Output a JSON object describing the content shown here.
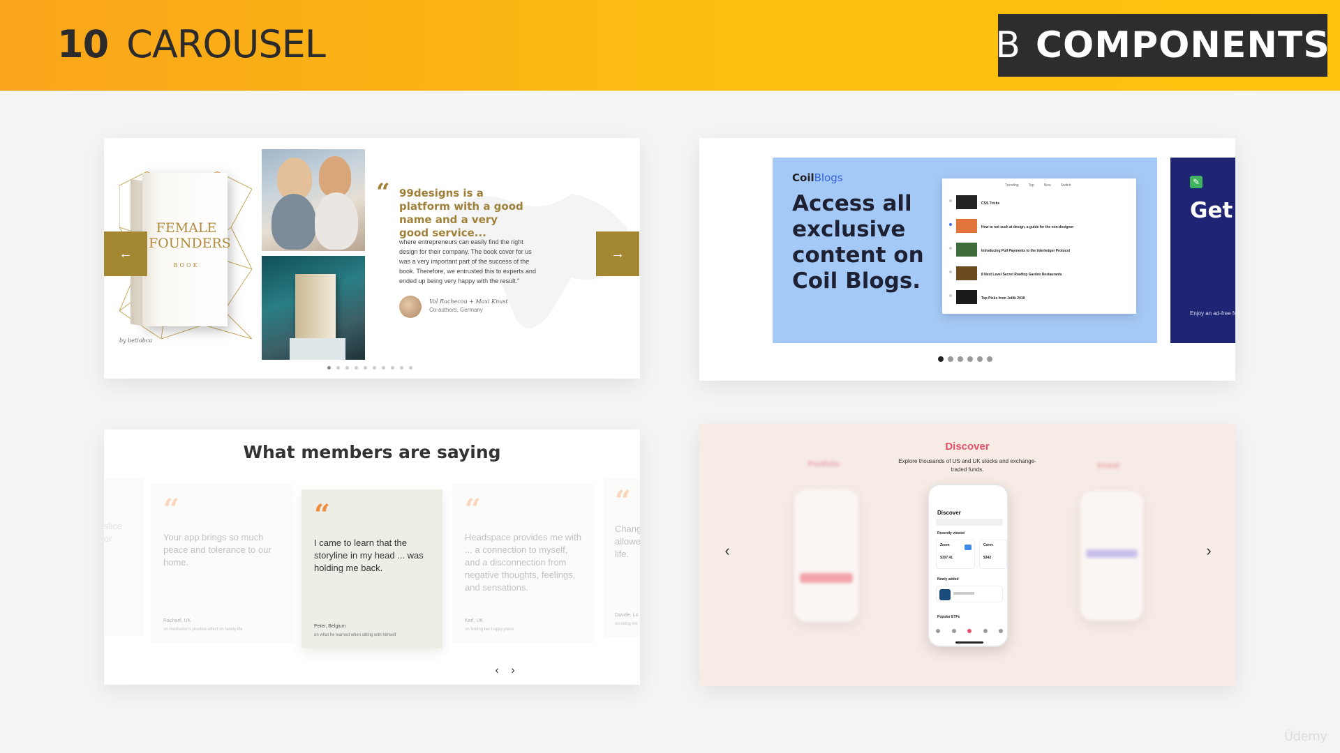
{
  "header": {
    "lecture_number": "10",
    "lecture_title": "CAROUSEL",
    "section_letter": "B",
    "section_name": "COMPONENTS",
    "gradient_colors": [
      "#f9a51a",
      "#ffc20e"
    ]
  },
  "designs_card": {
    "book_title": "FEMALE FOUNDERS",
    "book_sub": "BOOK",
    "book_credit": "by betiobca",
    "quote_title": "99designs is a platform with a good name and a very good service...",
    "quote_body": "where entrepreneurs can easily find the right design for their company. The book cover for us was a very important part of the success of the book. Therefore, we entrusted this to experts and ended up being very happy with the result.\"",
    "author": "Vol Rachecou + Maxi Knust",
    "role": "Co-authors, Germany",
    "prev_icon": "arrow-left-icon",
    "next_icon": "arrow-right-icon",
    "dot_count": 10,
    "active_dot": 0,
    "accent": "#a48732"
  },
  "coil_card": {
    "logo_coil": "Coil",
    "logo_blogs": "Blogs",
    "headline": "Access all exclusive content on Coil Blogs.",
    "tabs": [
      "Trending",
      "Top",
      "New",
      "Switch"
    ],
    "posts": [
      {
        "title": "CSS Tricks"
      },
      {
        "title": "How to not suck at design, a guide for the non-designer"
      },
      {
        "title": "Introducing Pull Payments to the Interledger Protocol"
      },
      {
        "title": "8 Next Level Secret Rooftop Garden Restaurants"
      },
      {
        "title": "Top Picks from Jollik 2019"
      }
    ],
    "next_headline": "Get Eme free.",
    "next_body": "Enjoy an ad-free features, and su",
    "dot_count": 6,
    "active_dot": 0,
    "slide_color": "#a5c9f6",
    "next_slide_color": "#1f2573"
  },
  "members_card": {
    "title": "What members are saying",
    "partial_left": "slice\nor",
    "testimonials": [
      {
        "text": "Your app brings so much peace and tolerance to our home.",
        "author": "Rachael, UK",
        "note": "on meditation's positive effect on family life"
      },
      {
        "text": "I came to learn that the storyline in my head ... was holding me back.",
        "author": "Peter, Belgium",
        "note": "on what he learned when sitting with himself"
      },
      {
        "text": "Headspace provides me with ... a connection to myself, and a disconnection from negative thoughts, feelings, and sensations.",
        "author": "Karl, UK",
        "note": "on finding her happy place"
      }
    ],
    "partial_right": "Chang\nallowe\nlife.",
    "partial_right_author": "Davide, Lo",
    "partial_right_note": "on using me",
    "prev_label": "‹",
    "next_label": "›",
    "quote_color": "#f08a3e"
  },
  "discover_card": {
    "title": "Discover",
    "subtitle": "Explore thousands of US and UK stocks and exchange-traded funds.",
    "left_label": "Portfolio",
    "right_label": "Invest",
    "phone_heading": "Discover",
    "recently_viewed": "Recently viewed",
    "newly_added": "Newly added",
    "popular": "Popular ETFs",
    "stock1": "Zoom",
    "stock1_price": "$107.41",
    "stock2": "Cerev",
    "stock2_price": "$342",
    "prev_label": "‹",
    "next_label": "›",
    "title_color": "#e2516a",
    "background": "#f7ebe6"
  },
  "watermark": "Ûdemy"
}
